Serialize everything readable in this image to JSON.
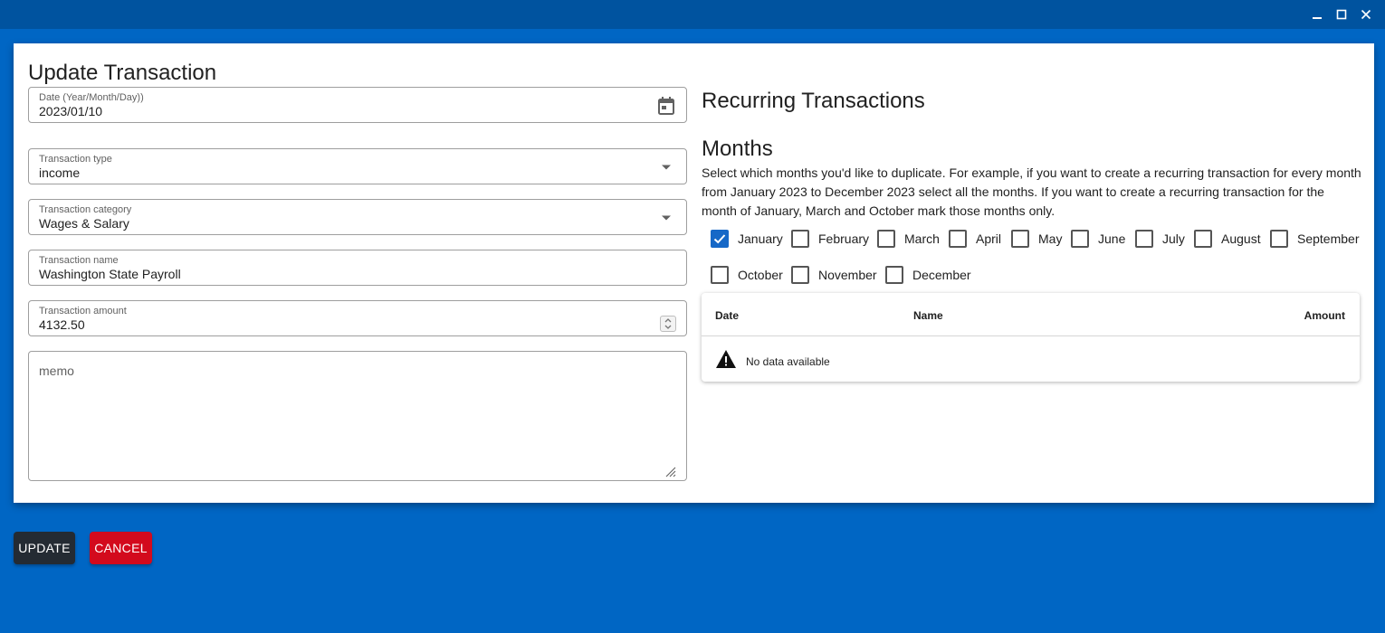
{
  "window": {
    "minimize_icon": "minimize-icon",
    "maximize_icon": "maximize-icon",
    "close_icon": "close-icon"
  },
  "dialog": {
    "title": "Update Transaction"
  },
  "form": {
    "date": {
      "label": "Date (Year/Month/Day))",
      "value": "2023/01/10",
      "icon": "calendar-icon"
    },
    "type": {
      "label": "Transaction type",
      "value": "income",
      "icon": "chevron-down-icon"
    },
    "category": {
      "label": "Transaction category",
      "value": "Wages & Salary",
      "icon": "chevron-down-icon"
    },
    "name": {
      "label": "Transaction name",
      "value": "Washington State Payroll"
    },
    "amount": {
      "label": "Transaction amount",
      "value": "4132.50",
      "icon": "stepper-icon"
    },
    "memo": {
      "placeholder": "memo",
      "value": ""
    }
  },
  "recurring": {
    "title": "Recurring Transactions",
    "months_title": "Months",
    "description": "Select which months you'd like to duplicate. For example, if you want to create a recurring transaction for every month from January 2023 to December 2023 select all the months. If you want to create a recurring transaction for the month of January, March and October mark those months only.",
    "months": [
      {
        "label": "January",
        "checked": true
      },
      {
        "label": "February",
        "checked": false
      },
      {
        "label": "March",
        "checked": false
      },
      {
        "label": "April",
        "checked": false
      },
      {
        "label": "May",
        "checked": false
      },
      {
        "label": "June",
        "checked": false
      },
      {
        "label": "July",
        "checked": false
      },
      {
        "label": "August",
        "checked": false
      },
      {
        "label": "September",
        "checked": false
      },
      {
        "label": "October",
        "checked": false
      },
      {
        "label": "November",
        "checked": false
      },
      {
        "label": "December",
        "checked": false
      }
    ],
    "table": {
      "columns": [
        "Date",
        "Name",
        "Amount"
      ],
      "empty_text": "No data available",
      "empty_icon": "warning-icon"
    }
  },
  "actions": {
    "update_label": "UPDATE",
    "cancel_label": "CANCEL"
  },
  "colors": {
    "titlebar": "#00539f",
    "background": "#0066c4",
    "checkbox_checked": "#1668c7",
    "update_button": "#242b33",
    "cancel_button": "#d30a1d"
  }
}
